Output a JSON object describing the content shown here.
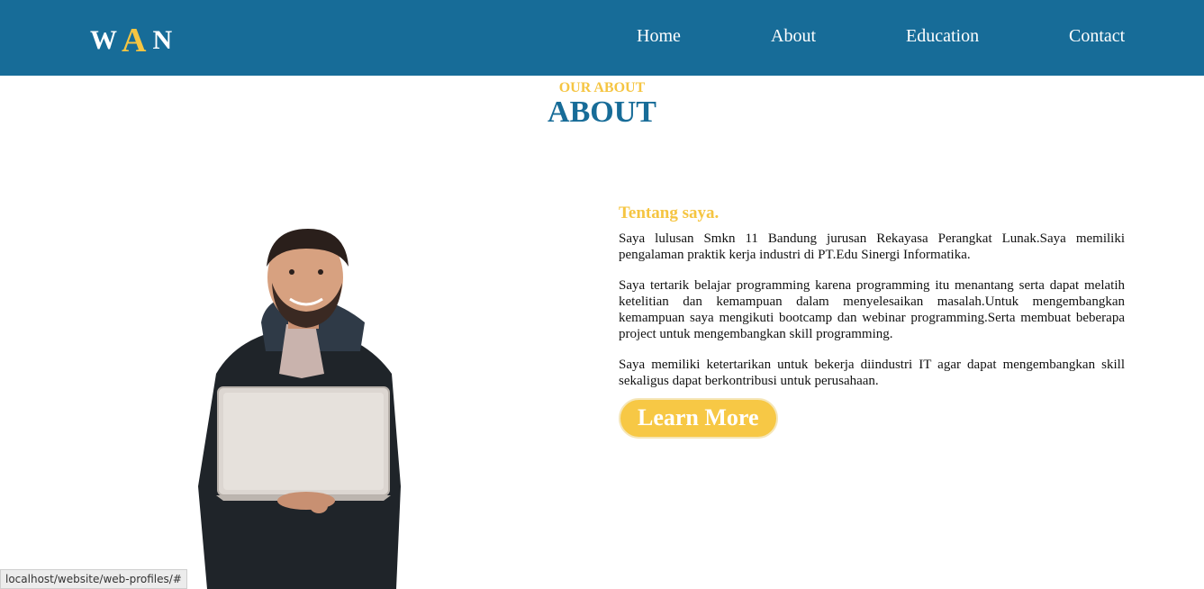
{
  "brand": {
    "l1": "W",
    "l2": "A",
    "l3": "N"
  },
  "nav": [
    {
      "label": "Home"
    },
    {
      "label": "About"
    },
    {
      "label": "Education"
    },
    {
      "label": "Contact"
    }
  ],
  "about": {
    "subtitle": "OUR ABOUT",
    "title": "ABOUT",
    "heading": "Tentang saya.",
    "paragraphs": [
      "Saya lulusan Smkn 11 Bandung jurusan Rekayasa Perangkat Lunak.Saya memiliki pengalaman praktik kerja industri di PT.Edu Sinergi Informatika.",
      "Saya tertarik belajar programming karena programming itu menantang serta dapat melatih ketelitian dan kemampuan dalam menyelesaikan masalah.Untuk mengembangkan kemampuan saya mengikuti bootcamp dan webinar programming.Serta membuat beberapa project untuk mengembangkan skill programming.",
      "Saya memiliki ketertarikan untuk bekerja diindustri IT agar dapat mengembangkan skill sekaligus dapat berkontribusi untuk perusahaan."
    ],
    "button_label": "Learn More"
  },
  "status_bar": {
    "url": "localhost/website/web-profiles/#"
  },
  "colors": {
    "nav_bg": "#176c98",
    "accent": "#f5c542",
    "title": "#176c98"
  }
}
